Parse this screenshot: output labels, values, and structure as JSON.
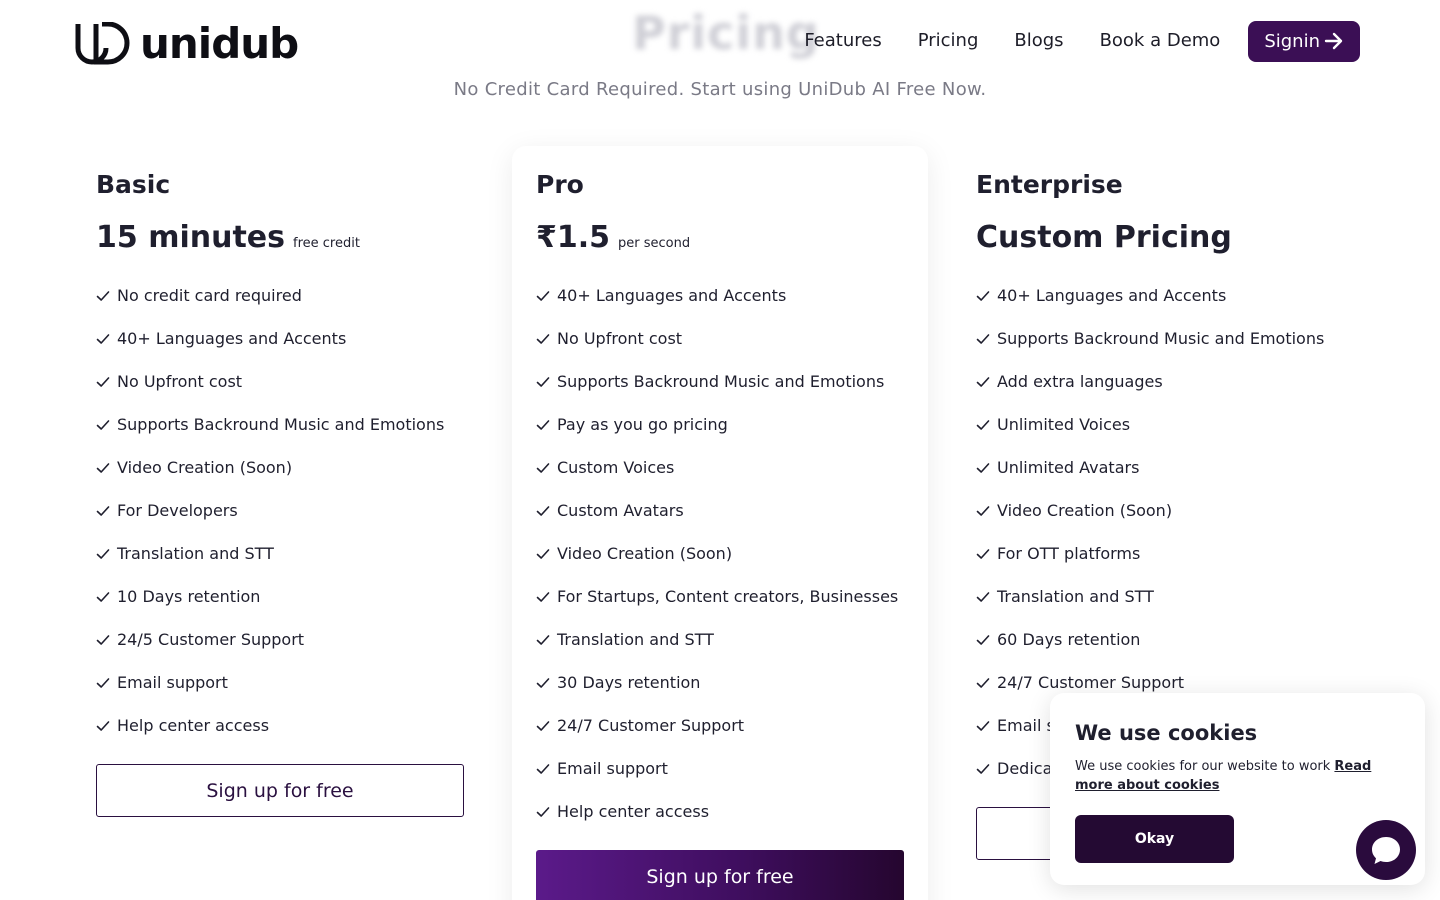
{
  "header": {
    "logo_text": "unidub",
    "faded_title": "Pricing",
    "nav": [
      {
        "label": "Features"
      },
      {
        "label": "Pricing"
      },
      {
        "label": "Blogs"
      },
      {
        "label": "Book a Demo"
      }
    ],
    "signin_label": "Signin"
  },
  "subtitle": "No Credit Card Required. Start using UniDub AI Free Now.",
  "plans": [
    {
      "name": "Basic",
      "price": "15 minutes",
      "price_note": "free credit",
      "features": [
        "No credit card required",
        "40+ Languages and Accents",
        "No Upfront cost",
        "Supports Backround Music and Emotions",
        "Video Creation (Soon)",
        "For Developers",
        "Translation and STT",
        "10 Days retention",
        "24/5 Customer Support",
        "Email support",
        "Help center access"
      ],
      "cta": "Sign up for free"
    },
    {
      "name": "Pro",
      "price": "₹1.5",
      "price_note": "per second",
      "features": [
        "40+ Languages and Accents",
        "No Upfront cost",
        "Supports Backround Music and Emotions",
        "Pay as you go pricing",
        "Custom Voices",
        "Custom Avatars",
        "Video Creation (Soon)",
        "For Startups, Content creators, Businesses",
        "Translation and STT",
        "30 Days retention",
        "24/7 Customer Support",
        "Email support",
        "Help center access"
      ],
      "cta": "Sign up for free"
    },
    {
      "name": "Enterprise",
      "price": "Custom Pricing",
      "price_note": "",
      "features": [
        "40+ Languages and Accents",
        "Supports Backround Music and Emotions",
        "Add extra languages",
        "Unlimited Voices",
        "Unlimited Avatars",
        "Video Creation (Soon)",
        "For OTT platforms",
        "Translation and STT",
        "60 Days retention",
        "24/7 Customer Support",
        "Email s",
        "Dedicat"
      ],
      "cta": ""
    }
  ],
  "cookie": {
    "title": "We use cookies",
    "text": "We use cookies for our website to work",
    "link": "Read more about cookies",
    "button": "Okay"
  },
  "colors": {
    "brand": "#3b0f55",
    "cta_gradient_start": "#5b1a8a",
    "cta_gradient_end": "#25062f"
  }
}
